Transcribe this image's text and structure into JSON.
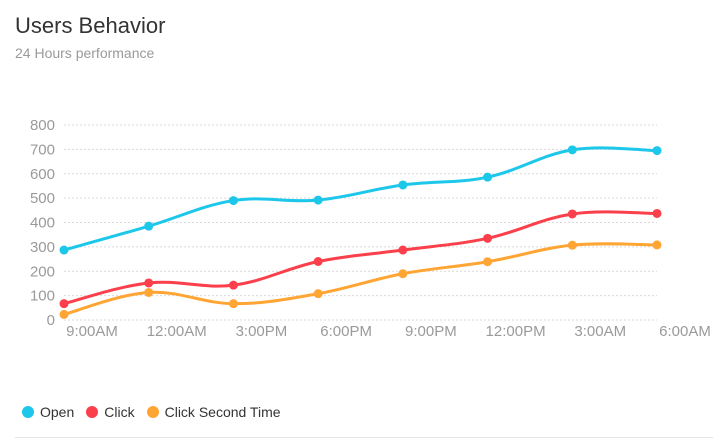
{
  "header": {
    "title": "Users Behavior",
    "subtitle": "24 Hours performance"
  },
  "chart_data": {
    "type": "line",
    "categories": [
      "9:00AM",
      "12:00AM",
      "3:00PM",
      "6:00PM",
      "9:00PM",
      "12:00PM",
      "3:00AM",
      "6:00AM"
    ],
    "series": [
      {
        "name": "Open",
        "color": "#1dc7ea",
        "values": [
          287,
          385,
          490,
          492,
          554,
          586,
          698,
          695
        ]
      },
      {
        "name": "Click",
        "color": "#fb404b",
        "values": [
          67,
          152,
          143,
          240,
          287,
          335,
          435,
          437
        ]
      },
      {
        "name": "Click Second Time",
        "color": "#ffa534",
        "values": [
          23,
          113,
          67,
          108,
          190,
          239,
          307,
          308
        ]
      }
    ],
    "y_ticks": [
      0,
      100,
      200,
      300,
      400,
      500,
      600,
      700,
      800
    ],
    "ylim": [
      0,
      800
    ],
    "grid": true,
    "legend": "bottom-left"
  }
}
